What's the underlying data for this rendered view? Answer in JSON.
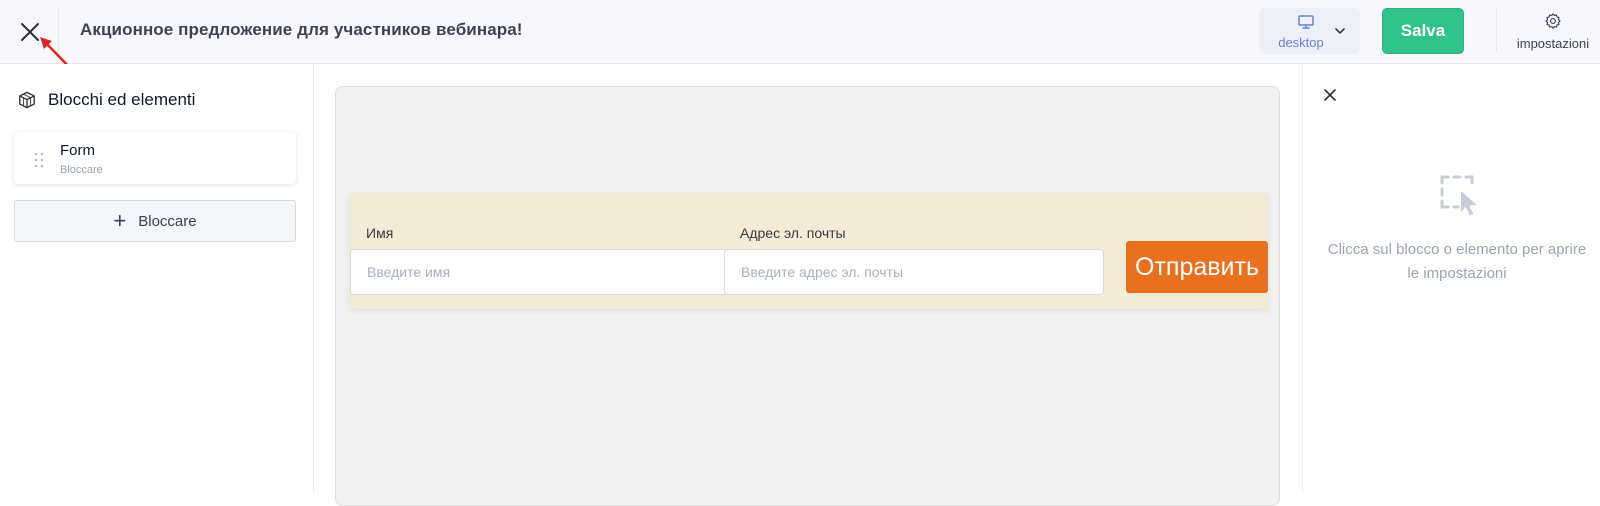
{
  "header": {
    "title": "Акционное предложение для участников вебинара!",
    "device_label": "desktop",
    "save_label": "Salva",
    "settings_label": "impostazioni"
  },
  "sidebar": {
    "title": "Blocchi ed elementi",
    "blocks": [
      {
        "name": "Form",
        "type": "Bloccare"
      }
    ],
    "add_block_label": "Bloccare"
  },
  "form": {
    "name_label": "Имя",
    "name_placeholder": "Введите имя",
    "email_label": "Адрес эл. почты",
    "email_placeholder": "Введите адрес эл. почты",
    "submit_label": "Отправить"
  },
  "right_panel": {
    "hint": "Clicca sul blocco o elemento per aprire le impostazioni"
  },
  "colors": {
    "save_button": "#2fc28a",
    "submit_button": "#e9701d",
    "form_background": "#f3ead8",
    "device_accent": "#6b7fd7",
    "annotation_arrow": "#e02424"
  },
  "icons": [
    "close-icon",
    "monitor-icon",
    "chevron-down-icon",
    "gear-icon",
    "cube-icon",
    "drag-handle-icon",
    "plus-icon",
    "select-cursor-icon"
  ]
}
